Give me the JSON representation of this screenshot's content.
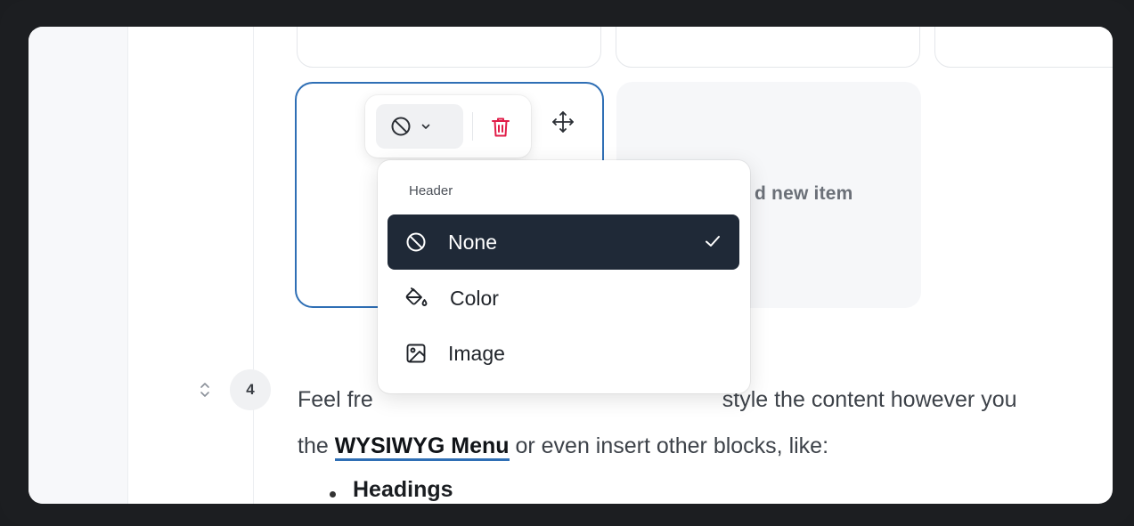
{
  "toolbar": {
    "header_icon": "ban-icon",
    "chevron_icon": "chevron-down-icon",
    "delete_icon": "trash-icon",
    "move_icon": "move-icon",
    "delete_color": "#e11d48"
  },
  "add_card": {
    "label": "d new item"
  },
  "header_menu": {
    "title": "Header",
    "items": [
      {
        "label": "None",
        "icon": "ban-icon",
        "selected": true
      },
      {
        "label": "Color",
        "icon": "paint-bucket-icon",
        "selected": false
      },
      {
        "label": "Image",
        "icon": "image-icon",
        "selected": false
      }
    ],
    "check_icon": "check-icon"
  },
  "content": {
    "row_number": "4",
    "line1_visible_left": "Feel fre",
    "line1_visible_right": "style the content however you",
    "line2_before": "the ",
    "line2_link": "WYSIWYG Menu",
    "line2_after": " or even insert other blocks, like:",
    "bullet": "Headings"
  },
  "colors": {
    "accent": "#2f6fb5",
    "menu_selected_bg": "#1f2937",
    "frame_bg": "#1c1e21"
  }
}
